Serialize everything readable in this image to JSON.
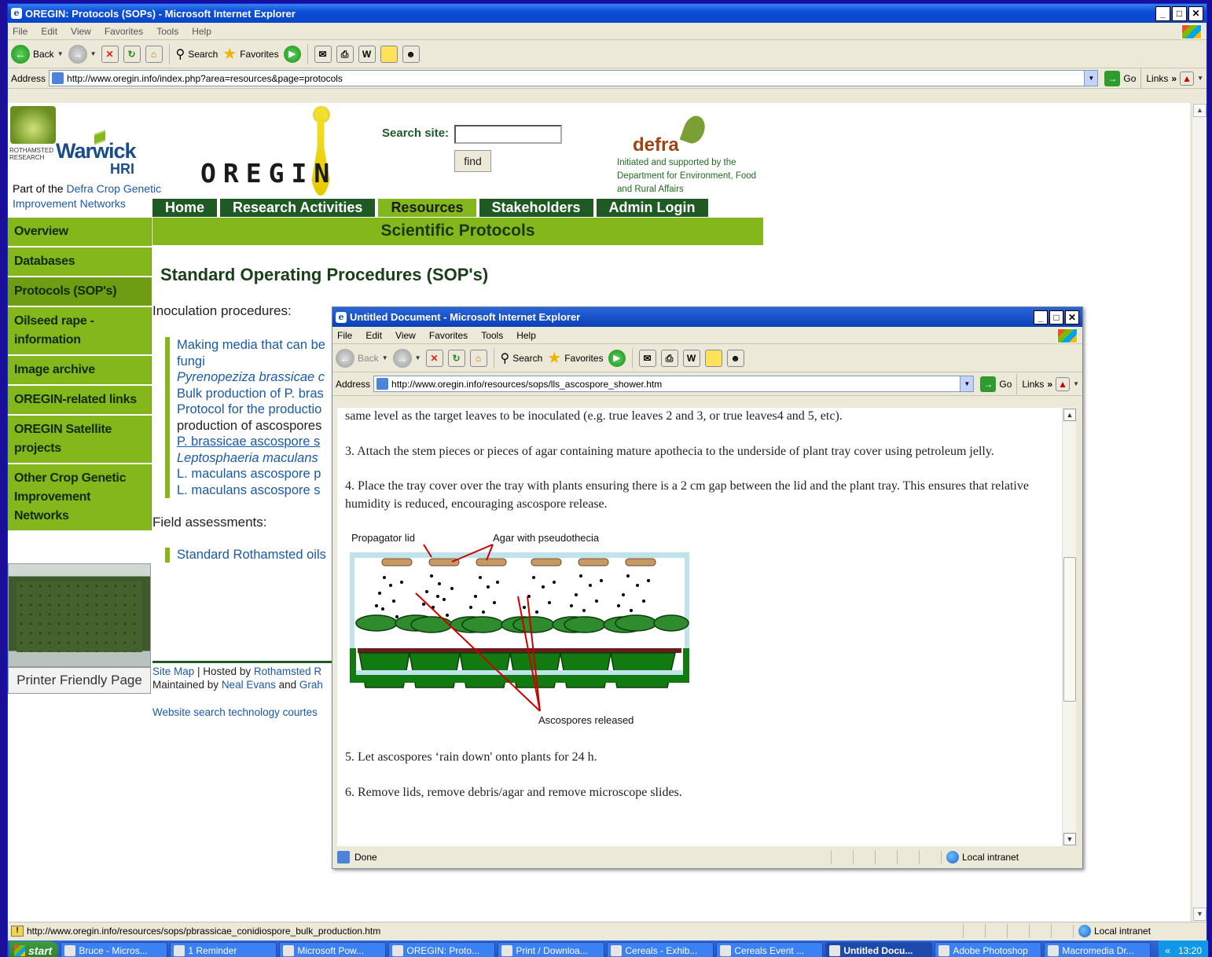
{
  "main_window": {
    "title": "OREGIN: Protocols (SOPs) - Microsoft Internet Explorer",
    "controls": [
      "_",
      "□",
      "✕"
    ],
    "menu": [
      "File",
      "Edit",
      "View",
      "Favorites",
      "Tools",
      "Help"
    ],
    "toolbar": {
      "back": "Back",
      "search": "Search",
      "favorites": "Favorites"
    },
    "address_label": "Address",
    "address": "http://www.oregin.info/index.php?area=resources&page=protocols",
    "go": "Go",
    "links": "Links",
    "status_url": "http://www.oregin.info/resources/sops/pbrassicae_conidiospore_bulk_production.htm",
    "status_zone": "Local intranet"
  },
  "site": {
    "rothamsted_label": "ROTHAMSTED RESEARCH",
    "warwick": "Warwick",
    "hri": "HRI",
    "part_of_prefix": "Part of the ",
    "part_of_link": "Defra Crop Genetic Improvement Networks",
    "oregin": "OREGIN",
    "search_label": "Search site:",
    "search_value": "",
    "find": "find",
    "defra": "defra",
    "defra_text": "Initiated and supported by the Department for Environment, Food and Rural Affairs",
    "nav": [
      "Home",
      "Research Activities",
      "Resources",
      "Stakeholders",
      "Admin Login"
    ],
    "sub_title": "Scientific Protocols",
    "sidebar": [
      "Overview",
      "Databases",
      "Protocols (SOP's)",
      "Oilseed rape - information",
      "Image archive",
      "OREGIN-related links",
      "OREGIN Satellite projects",
      "Other Crop Genetic Improvement Networks"
    ],
    "printer": "Printer Friendly Page",
    "page_title": "Standard Operating Procedures (SOP's)",
    "inoculation_label": "Inoculation procedures:",
    "protocols": [
      "Making media that can be",
      "fungi",
      "Pyrenopeziza brassicae c",
      "Bulk production of P. bras",
      "Protocol for the productio",
      "production of ascospores",
      "P. brassicae ascospore s",
      "Leptosphaeria maculans",
      "L. maculans ascospore p",
      "L. maculans ascospore s"
    ],
    "field_label": "Field assessments:",
    "field_items": [
      "Standard Rothamsted oils"
    ],
    "footer_line1_a": "Site Map",
    "footer_line1_b": " | Hosted by ",
    "footer_line1_c": "Rothamsted R",
    "footer_line2_a": "Maintained by ",
    "footer_line2_b": "Neal Evans",
    "footer_line2_c": " and ",
    "footer_line2_d": "Grah",
    "footer_search": "Website search technology courtes"
  },
  "popup": {
    "title": "Untitled Document - Microsoft Internet Explorer",
    "address": "http://www.oregin.info/resources/sops/lls_ascospore_shower.htm",
    "para_top": "same level as the target leaves to be inoculated (e.g. true leaves 2 and 3, or true leaves4 and 5, etc).",
    "step3": "3. Attach the stem pieces or pieces of agar containing mature apothecia to the underside of plant tray cover using petroleum jelly.",
    "step4": "4. Place the tray cover over the tray with plants ensuring there is a 2 cm gap between the lid and the plant tray. This ensures that relative humidity is reduced, encouraging ascospore release.",
    "diagram_labels": {
      "lid": "Propagator lid",
      "agar": "Agar with pseudothecia",
      "spores": "Ascospores released"
    },
    "step5": "5. Let ascospores ‘rain down' onto plants for 24 h.",
    "step6": "6. Remove lids, remove debris/agar and remove microscope slides.",
    "status": "Done",
    "zone": "Local intranet"
  },
  "taskbar": {
    "start": "start",
    "tasks": [
      "Bruce - Micros...",
      "1 Reminder",
      "Microsoft Pow...",
      "OREGIN: Proto...",
      "Print / Downloa...",
      "Cereals - Exhib...",
      "Cereals Event ...",
      "Untitled Docu...",
      "Adobe Photoshop",
      "Macromedia Dr..."
    ],
    "clock": "13:20",
    "chevron": "«"
  },
  "colors": {
    "nav_dark": "#1f5a24",
    "nav_light": "#84b71c",
    "link": "#1a5aa8"
  }
}
